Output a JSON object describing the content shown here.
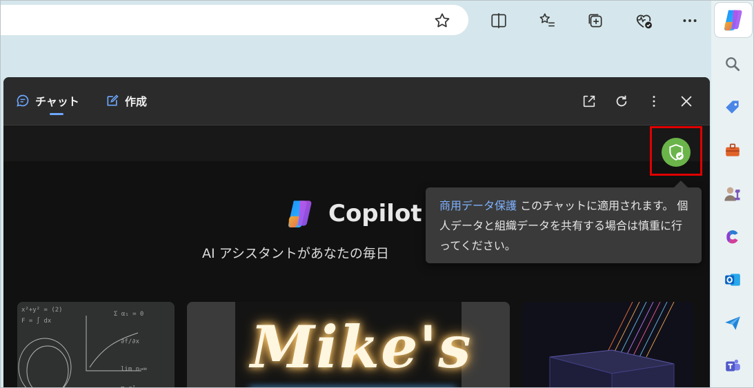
{
  "copilot": {
    "tabs": [
      {
        "label": "チャット",
        "active": true
      },
      {
        "label": "作成",
        "active": false
      }
    ],
    "brand": "Copilot",
    "subtitle": "AI アシスタントがあなたの毎日",
    "tooltip": {
      "link": "商用データ保護",
      "text": " このチャットに適用されます。 個人データと組織データを共有する場合は慎重に行ってください。"
    },
    "cards": [
      {
        "title": ""
      },
      {
        "title": "Mike's"
      },
      {
        "title": ""
      }
    ]
  },
  "colors": {
    "accent": "#6ea8ff",
    "shield": "#6ab44a",
    "highlight": "#e00000"
  }
}
